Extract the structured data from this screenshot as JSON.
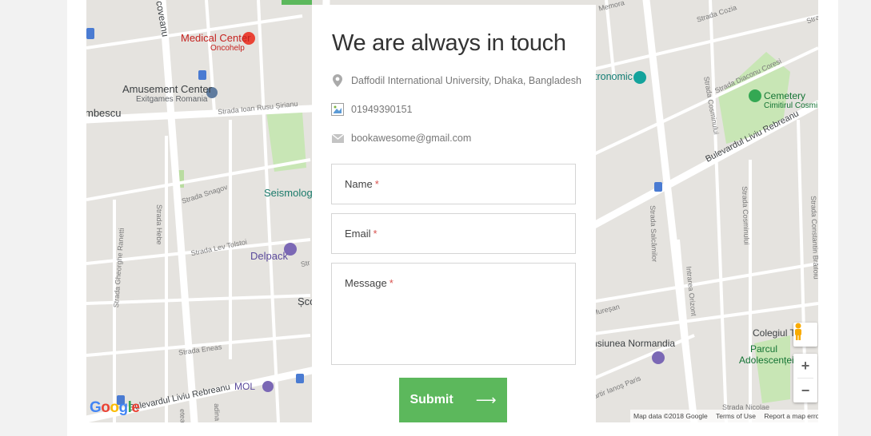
{
  "contact": {
    "title": "We are always in touch",
    "address": "Daffodil International University, Dhaka, Bangladesh",
    "phone": "01949390151",
    "email": "bookawesome@gmail.com",
    "icons": {
      "address": "map-pin-icon",
      "phone": "broken-image-icon",
      "email": "envelope-icon"
    }
  },
  "form": {
    "name_label": "Name",
    "email_label": "Email",
    "message_label": "Message",
    "required_mark": "*",
    "submit_label": "Submit",
    "submit_arrow": "⟶"
  },
  "map": {
    "pois": {
      "medical_center": "Medical Center",
      "oncohelp": "Oncohelp",
      "amusement_center": "Amusement Center",
      "exitgames": "Exitgames Romania",
      "seismologic": "Seismologic",
      "delpack": "Delpack",
      "mol": "MOL",
      "scoala": "Șco",
      "tronomic": "tronomic",
      "cemetery": "Cemetery",
      "cimitirul": "Cimitirul Cosmin",
      "colegiul": "Colegiul T",
      "colegiul_c": "c",
      "parcul": "Parcul",
      "adolescentei": "Adolescenței",
      "normandia": "nsiunea Normandia",
      "mbescu": "mbescu",
      "coveanu": "coveanu"
    },
    "streets": {
      "ioan_rusu": "Strada Ioan Rusu Șirianu",
      "snagov": "Strada Snagov",
      "hebe": "Strada Hebe",
      "lev_tolstoi": "Strada Lev Tolstoi",
      "gheorghe_ranetti": "Strada Gheorghe Ranetti",
      "eneas": "Strada Eneas",
      "bulevardul_bottom": "Bulevardul Liviu Rebreanu",
      "bulevardul_right": "Bulevardul Liviu Rebreanu",
      "cozia": "Strada Cozia",
      "diaconu_coresi": "Strada Diaconu Coresi",
      "cosminului": "Strada Cosminului",
      "cosminului2": "Strada Cosminului",
      "salcamilor": "Strada Salcâmilor",
      "intrarea_orizont": "Intrarea Orizont",
      "constantin_brailoiu": "Strada Constantin Brăiloiu",
      "muresan": "Mureșan",
      "ianos_paris": "artir Ianoș Paris",
      "nicolae": "Strada Nicolae",
      "memorandumului": "Memora",
      "stra": "Strad",
      "str_short": "Str",
      "tea": "etea",
      "padina": "adina"
    },
    "attribution": {
      "data": "Map data ©2018 Google",
      "terms": "Terms of Use",
      "report": "Report a map error"
    },
    "logo": "Google",
    "controls": {
      "zoom_in": "+",
      "zoom_out": "−"
    }
  },
  "colors": {
    "accent": "#5cb85c",
    "required": "#d9534f",
    "map_bg": "#e5e3df",
    "park": "#c8e6b5"
  }
}
